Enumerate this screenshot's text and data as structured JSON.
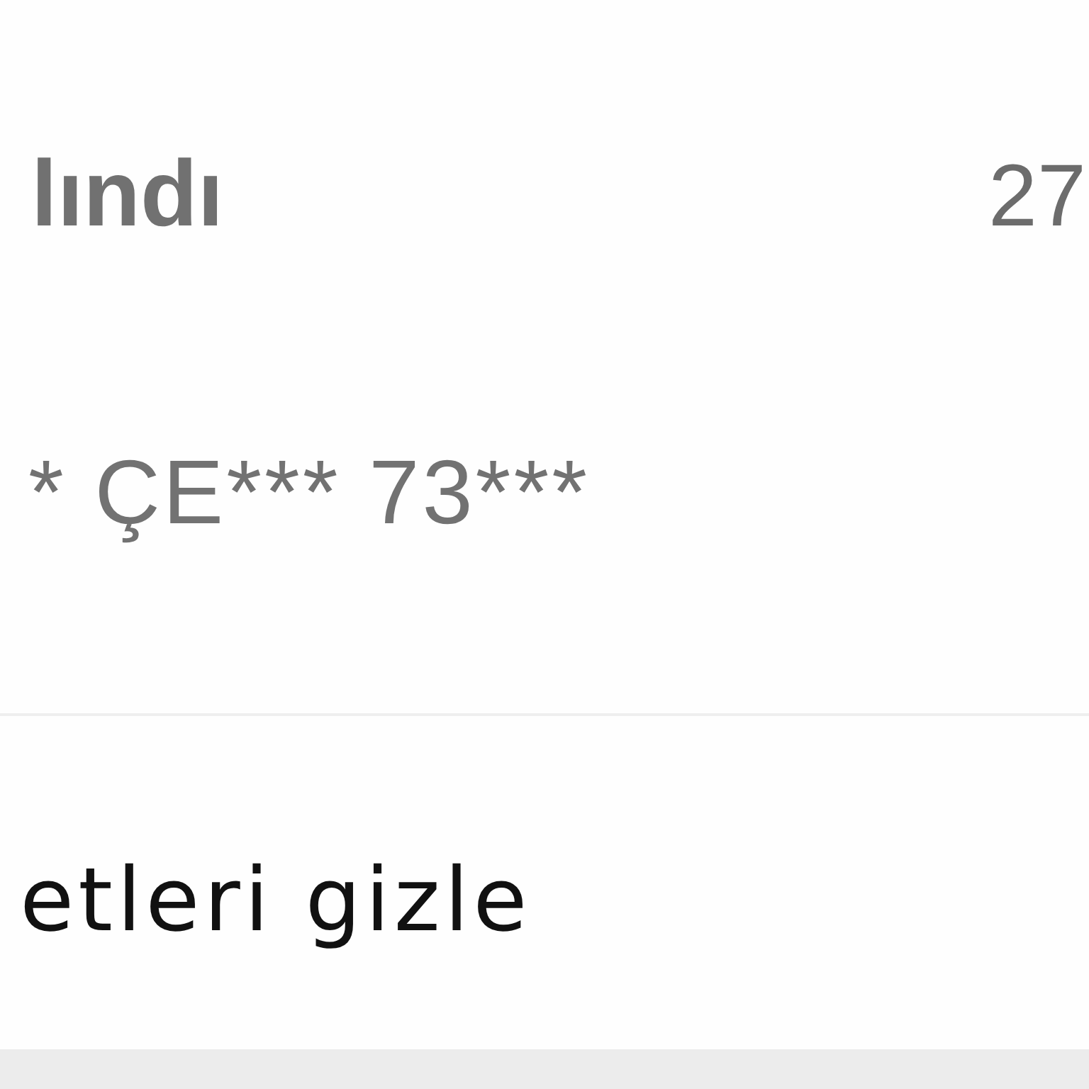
{
  "shipment": {
    "status": "lındı",
    "date": "27",
    "recipient": "* ÇE*** 73***"
  },
  "toggle_link": {
    "label": "etleri gizle"
  }
}
